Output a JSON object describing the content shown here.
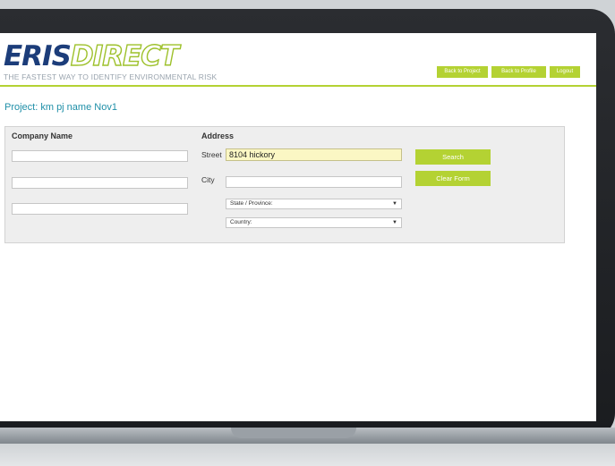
{
  "brand": {
    "logo_part1": "ER",
    "logo_part2": "IS",
    "logo_part3": "DIRECT",
    "tagline": "THE FASTEST WAY TO IDENTIFY ENVIRONMENTAL RISK",
    "primary_color": "#1c3d7a",
    "accent_color": "#b4d233"
  },
  "header": {
    "back_to_project": "Back to Project",
    "back_to_profile": "Back to Profile",
    "logout": "Logout"
  },
  "project": {
    "title": "Project: km pj name Nov1"
  },
  "form": {
    "company_name_label": "Company Name",
    "company_fields": [
      "",
      "",
      ""
    ],
    "address_label": "Address",
    "street_label": "Street",
    "street_value": "8104 hickory",
    "city_label": "City",
    "city_value": "",
    "state_selected": "State / Province:",
    "country_selected": "Country:",
    "search_button": "Search",
    "clear_button": "Clear Form"
  }
}
